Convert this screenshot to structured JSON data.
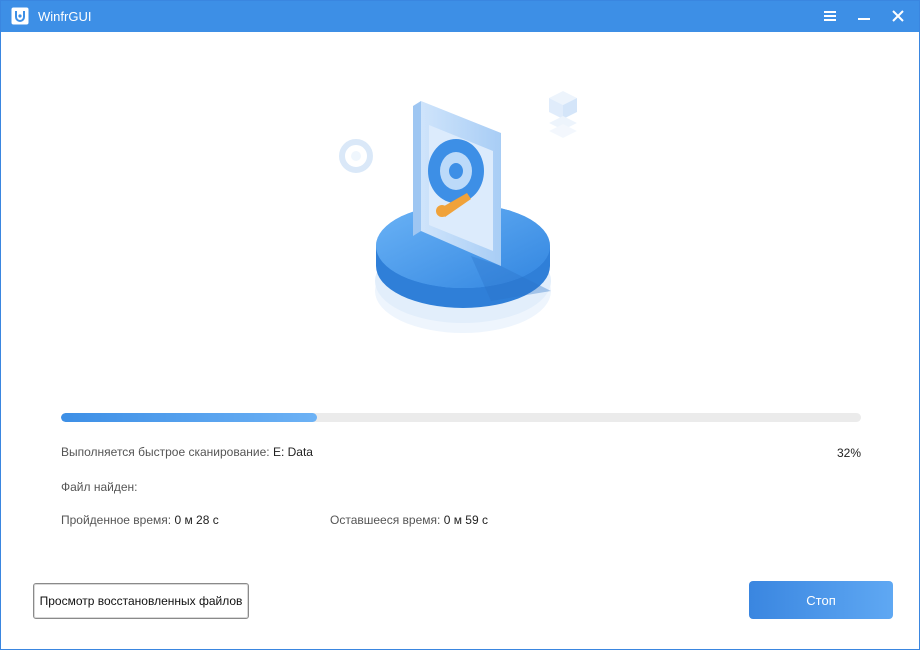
{
  "window": {
    "title": "WinfrGUI"
  },
  "icons": {
    "app": "winfr-app-icon",
    "menu": "hamburger-menu-icon",
    "minimize": "minimize-icon",
    "close": "close-icon"
  },
  "scan": {
    "progress_percent": 32,
    "progress_label": "32%",
    "status_label": "Выполняется быстрое сканирование",
    "status_sep": ":",
    "drive": "E: Data",
    "found_label": "Файл найден",
    "found_sep": ":",
    "elapsed_label": "Пройденное время",
    "elapsed_sep": ":",
    "elapsed_value": "0 м 28 с",
    "remaining_label": "Оставшееся время",
    "remaining_sep": ":",
    "remaining_value": "0 м 59 с"
  },
  "buttons": {
    "view_recovered": "Просмотр восстановленных файлов",
    "stop": "Стоп"
  },
  "colors": {
    "titlebar": "#3d8fe6",
    "accent": "#3d8fe6",
    "track": "#ebebeb"
  }
}
